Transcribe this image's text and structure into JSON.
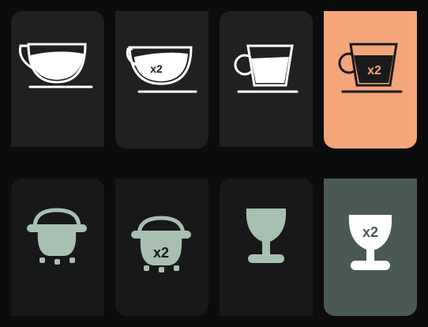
{
  "colors": {
    "background": "#0c0c0d",
    "tile_dark": "#202022",
    "tile_darker": "#18181a",
    "tile_selected_orange": "#f4a67a",
    "tile_selected_green": "#4a5a52",
    "icon_outline": "#ffffff",
    "icon_fill_sage": "#a7c0b2",
    "icon_dark_stroke": "#1a1a1a"
  },
  "drinks": [
    {
      "icon": "coffee-cup-icon",
      "badge": "",
      "selected": false
    },
    {
      "icon": "coffee-cup-double-icon",
      "badge": "x2",
      "selected": false
    },
    {
      "icon": "tall-cup-icon",
      "badge": "",
      "selected": false
    },
    {
      "icon": "espresso-cup-double-icon",
      "badge": "x2",
      "selected": true
    },
    {
      "icon": "carafe-icon",
      "badge": "",
      "selected": false
    },
    {
      "icon": "carafe-double-icon",
      "badge": "x2",
      "selected": false
    },
    {
      "icon": "glass-icon",
      "badge": "",
      "selected": false
    },
    {
      "icon": "glass-double-icon",
      "badge": "x2",
      "selected": true
    }
  ]
}
